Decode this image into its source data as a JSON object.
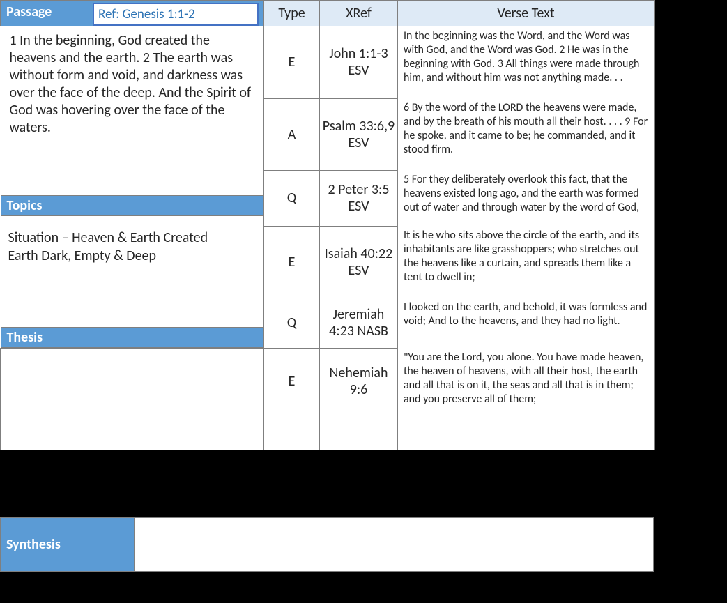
{
  "headers": {
    "passage": "Passage",
    "ref_label": "Ref: Genesis 1:1-2",
    "type": "Type",
    "xref": "XRef",
    "verse_text": "Verse Text"
  },
  "passage_body": "1 In the beginning, God created the heavens and the earth. 2 The earth was without form and void, and darkness was over the face of the deep. And the Spirit of God was hovering over the face of the waters.",
  "sections": {
    "topics": "Topics",
    "thesis": "Thesis",
    "synthesis": "Synthesis"
  },
  "topics_body_line1": "Situation – Heaven & Earth Created",
  "topics_body_line2": "Earth Dark, Empty & Deep",
  "rows": [
    {
      "type": "E",
      "xref": "John 1:1-3 ESV",
      "verse": "In the beginning was the Word, and the Word was with God, and the Word was God. 2 He was in the beginning with God. 3 All things were made through him, and without him was not anything made. . ."
    },
    {
      "type": "A",
      "xref": "Psalm 33:6,9 ESV",
      "verse": "6 By the word of the LORD the heavens were made, and by the breath of his mouth all their host. . . . 9  For he spoke, and it came to be; he commanded, and it stood firm."
    },
    {
      "type": "Q",
      "xref": "2 Peter 3:5 ESV",
      "verse": "5 For they deliberately overlook this fact, that the heavens existed long ago, and the earth was formed out of water and through water by the word of God,"
    },
    {
      "type": "E",
      "xref": "Isaiah 40:22 ESV",
      "verse": "It is he who sits above the circle of the earth, and its inhabitants are like grasshoppers; who stretches out the heavens like a curtain, and spreads them like a tent to dwell in;"
    },
    {
      "type": "Q",
      "xref": "Jeremiah 4:23 NASB",
      "verse": "I looked on the earth, and behold, it was formless and void; And to the heavens, and they had no light."
    },
    {
      "type": "E",
      "xref": "Nehemiah 9:6",
      "verse": "\"You are the Lord, you alone. You have made heaven, the heaven of heavens, with all their host, the earth and all that is on it, the seas and all that is in them; and you preserve all of them;"
    }
  ]
}
